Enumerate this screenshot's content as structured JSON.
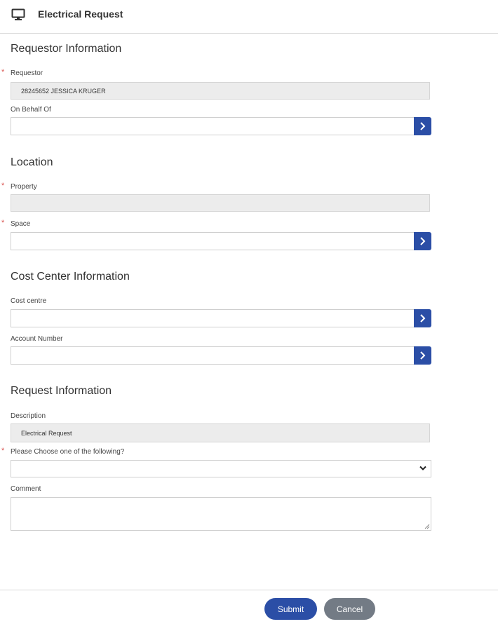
{
  "header": {
    "title": "Electrical Request",
    "icon": "monitor-icon"
  },
  "sections": {
    "requestor": {
      "title": "Requestor Information",
      "requestor_label": "Requestor",
      "requestor_value": "28245652 JESSICA KRUGER",
      "on_behalf_label": "On Behalf Of",
      "on_behalf_value": ""
    },
    "location": {
      "title": "Location",
      "property_label": "Property",
      "property_value": "",
      "space_label": "Space",
      "space_value": ""
    },
    "cost_center": {
      "title": "Cost Center Information",
      "cost_centre_label": "Cost centre",
      "cost_centre_value": "",
      "account_number_label": "Account Number",
      "account_number_value": ""
    },
    "request": {
      "title": "Request Information",
      "description_label": "Description",
      "description_value": "Electrical Request",
      "choose_label": "Please Choose one of the following?",
      "choose_value": "",
      "comment_label": "Comment",
      "comment_value": ""
    }
  },
  "required_marker": "*",
  "footer": {
    "submit_label": "Submit",
    "cancel_label": "Cancel"
  },
  "colors": {
    "primary": "#2b4ea6",
    "secondary": "#737b85",
    "required": "#d9534f",
    "readonly_bg": "#ececec"
  }
}
